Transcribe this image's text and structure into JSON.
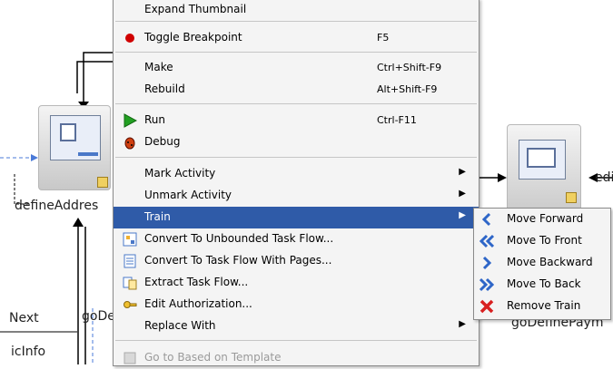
{
  "diagram": {
    "left_node_label": "defineAddres",
    "right_node_label": "goDefinePaym",
    "edge_label_next": "Next",
    "edge_label_gode": "goDe",
    "edge_label_ctl": "icInfo",
    "edge_label_edi": "edi"
  },
  "context_menu": {
    "items": [
      {
        "id": "expand",
        "label": "Expand Thumbnail",
        "shortcut": "",
        "icon": "",
        "disabled": false
      },
      {
        "id": "toggle-breakpoint",
        "label": "Toggle Breakpoint",
        "shortcut": "F5",
        "icon": "breakpoint-dot-icon"
      },
      {
        "id": "make",
        "label": "Make",
        "shortcut": "Ctrl+Shift-F9",
        "icon": ""
      },
      {
        "id": "rebuild",
        "label": "Rebuild",
        "shortcut": "Alt+Shift-F9",
        "icon": ""
      },
      {
        "id": "run",
        "label": "Run",
        "shortcut": "Ctrl-F11",
        "icon": "run-triangle-icon"
      },
      {
        "id": "debug",
        "label": "Debug",
        "shortcut": "",
        "icon": "debug-bug-icon"
      },
      {
        "id": "mark-activity",
        "label": "Mark Activity",
        "submenu": true
      },
      {
        "id": "unmark-activity",
        "label": "Unmark Activity",
        "submenu": true
      },
      {
        "id": "train",
        "label": "Train",
        "submenu": true,
        "highlighted": true
      },
      {
        "id": "convert-unbounded",
        "label": "Convert To Unbounded Task Flow...",
        "icon": "task-flow-icon"
      },
      {
        "id": "convert-pages",
        "label": "Convert To Task Flow With Pages...",
        "icon": "pages-icon"
      },
      {
        "id": "extract",
        "label": "Extract Task Flow...",
        "icon": "extract-icon"
      },
      {
        "id": "edit-auth",
        "label": "Edit Authorization...",
        "icon": "key-icon"
      },
      {
        "id": "replace-with",
        "label": "Replace With",
        "submenu": true
      },
      {
        "id": "go-template",
        "label": "Go to Based on Template",
        "icon": "template-icon",
        "disabled": true
      }
    ]
  },
  "train_submenu": {
    "items": [
      {
        "label": "Move Forward",
        "icon": "move-forward-icon",
        "color": "#2e66c8"
      },
      {
        "label": "Move To Front",
        "icon": "move-to-front-icon",
        "color": "#2e66c8"
      },
      {
        "label": "Move Backward",
        "icon": "move-backward-icon",
        "color": "#2e66c8"
      },
      {
        "label": "Move To Back",
        "icon": "move-to-back-icon",
        "color": "#2e66c8"
      },
      {
        "label": "Remove Train",
        "icon": "remove-x-icon",
        "color": "#d82020"
      }
    ]
  },
  "colors": {
    "highlight": "#2f5ba8",
    "menu_bg": "#f4f4f4",
    "breakpoint": "#d00000",
    "run": "#22a022"
  }
}
